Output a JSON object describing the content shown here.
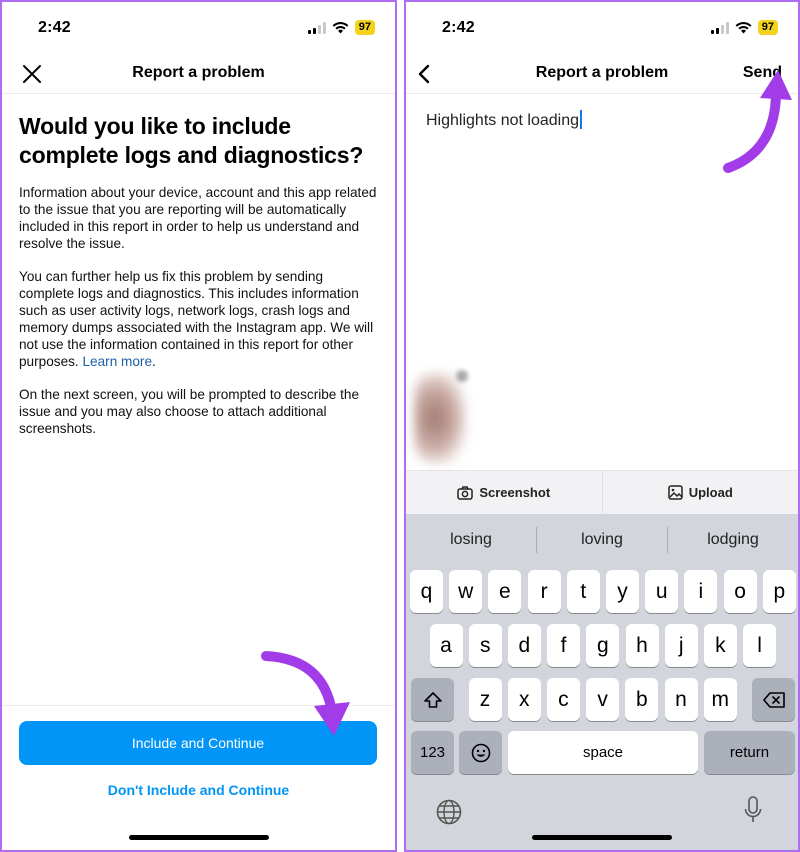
{
  "left_screen": {
    "status": {
      "time": "2:42",
      "battery": "97"
    },
    "nav": {
      "title": "Report a problem",
      "close_icon": "close-icon"
    },
    "heading": "Would you like to include complete logs and diagnostics?",
    "paragraph1": "Information about your device, account and this app related to the issue that you are reporting will be automatically included in this report in order to help us understand and resolve the issue.",
    "paragraph2": "You can further help us fix this problem by sending complete logs and diagnostics. This includes information such as user activity logs, network logs, crash logs and memory dumps associated with the Instagram app. We will not use the information contained in this report for other purposes.",
    "learn_more": "Learn more",
    "paragraph3": "On the next screen, you will be prompted to describe the issue and you may also choose to attach additional screenshots.",
    "primary_button": "Include and Continue",
    "secondary_button": "Don't Include and Continue"
  },
  "right_screen": {
    "status": {
      "time": "2:42",
      "battery": "97"
    },
    "nav": {
      "title": "Report a problem",
      "send": "Send",
      "back_icon": "chevron-left-icon"
    },
    "input_text": "Highlights not loading",
    "attach": {
      "screenshot": "Screenshot",
      "upload": "Upload"
    },
    "keyboard": {
      "suggestions": [
        "losing",
        "loving",
        "lodging"
      ],
      "row1": [
        "q",
        "w",
        "e",
        "r",
        "t",
        "y",
        "u",
        "i",
        "o",
        "p"
      ],
      "row2": [
        "a",
        "s",
        "d",
        "f",
        "g",
        "h",
        "j",
        "k",
        "l"
      ],
      "row3": [
        "z",
        "x",
        "c",
        "v",
        "b",
        "n",
        "m"
      ],
      "numbers_key": "123",
      "space_key": "space",
      "return_key": "return"
    }
  },
  "colors": {
    "accent": "#0095f6",
    "annotation_arrow": "#a13ce8",
    "battery": "#f5d31c"
  }
}
